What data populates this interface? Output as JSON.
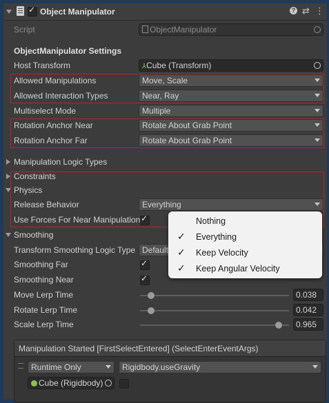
{
  "header": {
    "title": "Object Manipulator",
    "enabled": true
  },
  "script": {
    "label": "Script",
    "value": "ObjectManipulator"
  },
  "settings_heading": "ObjectManipulator Settings",
  "host_transform": {
    "label": "Host Transform",
    "value": "Cube (Transform)"
  },
  "allowed_manipulations": {
    "label": "Allowed Manipulations",
    "value": "Move, Scale"
  },
  "allowed_interaction_types": {
    "label": "Allowed Interaction Types",
    "value": "Near, Ray"
  },
  "multiselect_mode": {
    "label": "Multiselect Mode",
    "value": "Multiple"
  },
  "rotation_anchor_near": {
    "label": "Rotation Anchor Near",
    "value": "Rotate About Grab Point"
  },
  "rotation_anchor_far": {
    "label": "Rotation Anchor Far",
    "value": "Rotate About Grab Point"
  },
  "manipulation_logic_types": "Manipulation Logic Types",
  "constraints": "Constraints",
  "physics": {
    "label": "Physics",
    "release_behavior": {
      "label": "Release Behavior",
      "value": "Everything"
    },
    "use_forces": {
      "label": "Use Forces For Near Manipulation",
      "checked": true
    }
  },
  "smoothing": {
    "label": "Smoothing",
    "logic_type": {
      "label": "Transform Smoothing Logic Type",
      "value": "Default"
    },
    "smoothing_far": {
      "label": "Smoothing Far",
      "checked": true
    },
    "smoothing_near": {
      "label": "Smoothing Near",
      "checked": true
    },
    "move_lerp": {
      "label": "Move Lerp Time",
      "value": "0.038",
      "fraction": 0.038
    },
    "rotate_lerp": {
      "label": "Rotate Lerp Time",
      "value": "0.042",
      "fraction": 0.042
    },
    "scale_lerp": {
      "label": "Scale Lerp Time",
      "value": "0.965",
      "fraction": 0.965
    }
  },
  "release_popup": {
    "items": [
      {
        "label": "Nothing",
        "checked": false
      },
      {
        "label": "Everything",
        "checked": true
      },
      {
        "label": "Keep Velocity",
        "checked": true
      },
      {
        "label": "Keep Angular Velocity",
        "checked": true
      }
    ]
  },
  "event": {
    "title": "Manipulation Started [FirstSelectEntered] (SelectEnterEventArgs)",
    "runtime": "Runtime Only",
    "function": "Rigidbody.useGravity",
    "target": "Cube (Rigidbody)"
  },
  "colors": {
    "highlight": "#b5262b",
    "background": "#3c3c3c"
  }
}
